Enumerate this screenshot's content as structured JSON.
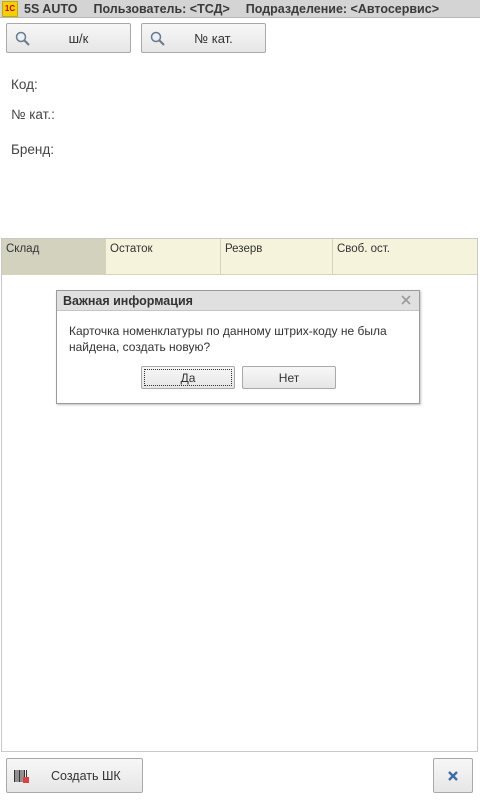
{
  "titlebar": {
    "logo": "1С",
    "app": "5S AUTO",
    "user": "Пользователь: <ТСД>",
    "division": "Подразделение: <Автосервис>"
  },
  "toolbar": {
    "barcode_button": "ш/к",
    "catalog_button": "№ кат."
  },
  "fields": {
    "code_label": "Код:",
    "catalog_label": "№ кат.:",
    "brand_label": "Бренд:"
  },
  "grid": {
    "columns": [
      "Склад",
      "Остаток",
      "Резерв",
      "Своб. ост."
    ]
  },
  "dialog": {
    "title": "Важная информация",
    "message": "Карточка номенклатуры по данному штрих-коду не была найдена, создать новую?",
    "yes": "Да",
    "no": "Нет"
  },
  "bottom": {
    "create_barcode": "Создать ШК"
  },
  "icons": {
    "search": "magnifier-icon",
    "close": "close-icon",
    "barcode": "barcode-icon",
    "cancel": "x-icon"
  }
}
